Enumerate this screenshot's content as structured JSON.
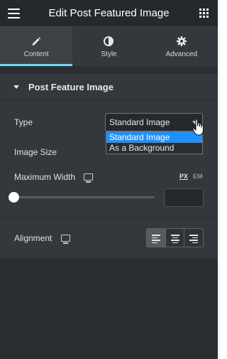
{
  "header": {
    "title": "Edit Post Featured Image",
    "menu_icon": "hamburger-icon",
    "apps_icon": "grid-icon"
  },
  "tabs": [
    {
      "label": "Content",
      "icon": "pencil-icon",
      "active": true
    },
    {
      "label": "Style",
      "icon": "half-circle-icon",
      "active": false
    },
    {
      "label": "Advanced",
      "icon": "gear-icon",
      "active": false
    }
  ],
  "section": {
    "title": "Post Feature Image"
  },
  "controls": {
    "type": {
      "label": "Type",
      "value": "Standard Image",
      "options": [
        "Standard Image",
        "As a Background"
      ],
      "highlighted_option": "Standard Image"
    },
    "image_size": {
      "label": "Image Size"
    },
    "max_width": {
      "label": "Maximum Width",
      "unit_px": "PX",
      "unit_em": "EM",
      "selected_unit": "PX",
      "slider_fraction": 0,
      "value": ""
    },
    "alignment": {
      "label": "Alignment",
      "options": [
        "align-left-icon",
        "align-center-icon",
        "align-right-icon"
      ],
      "selected": "align-left-icon"
    }
  },
  "colors": {
    "accent": "#71d7f7",
    "panel": "#34383c",
    "header": "#26292c",
    "selection": "#1e90ff"
  }
}
